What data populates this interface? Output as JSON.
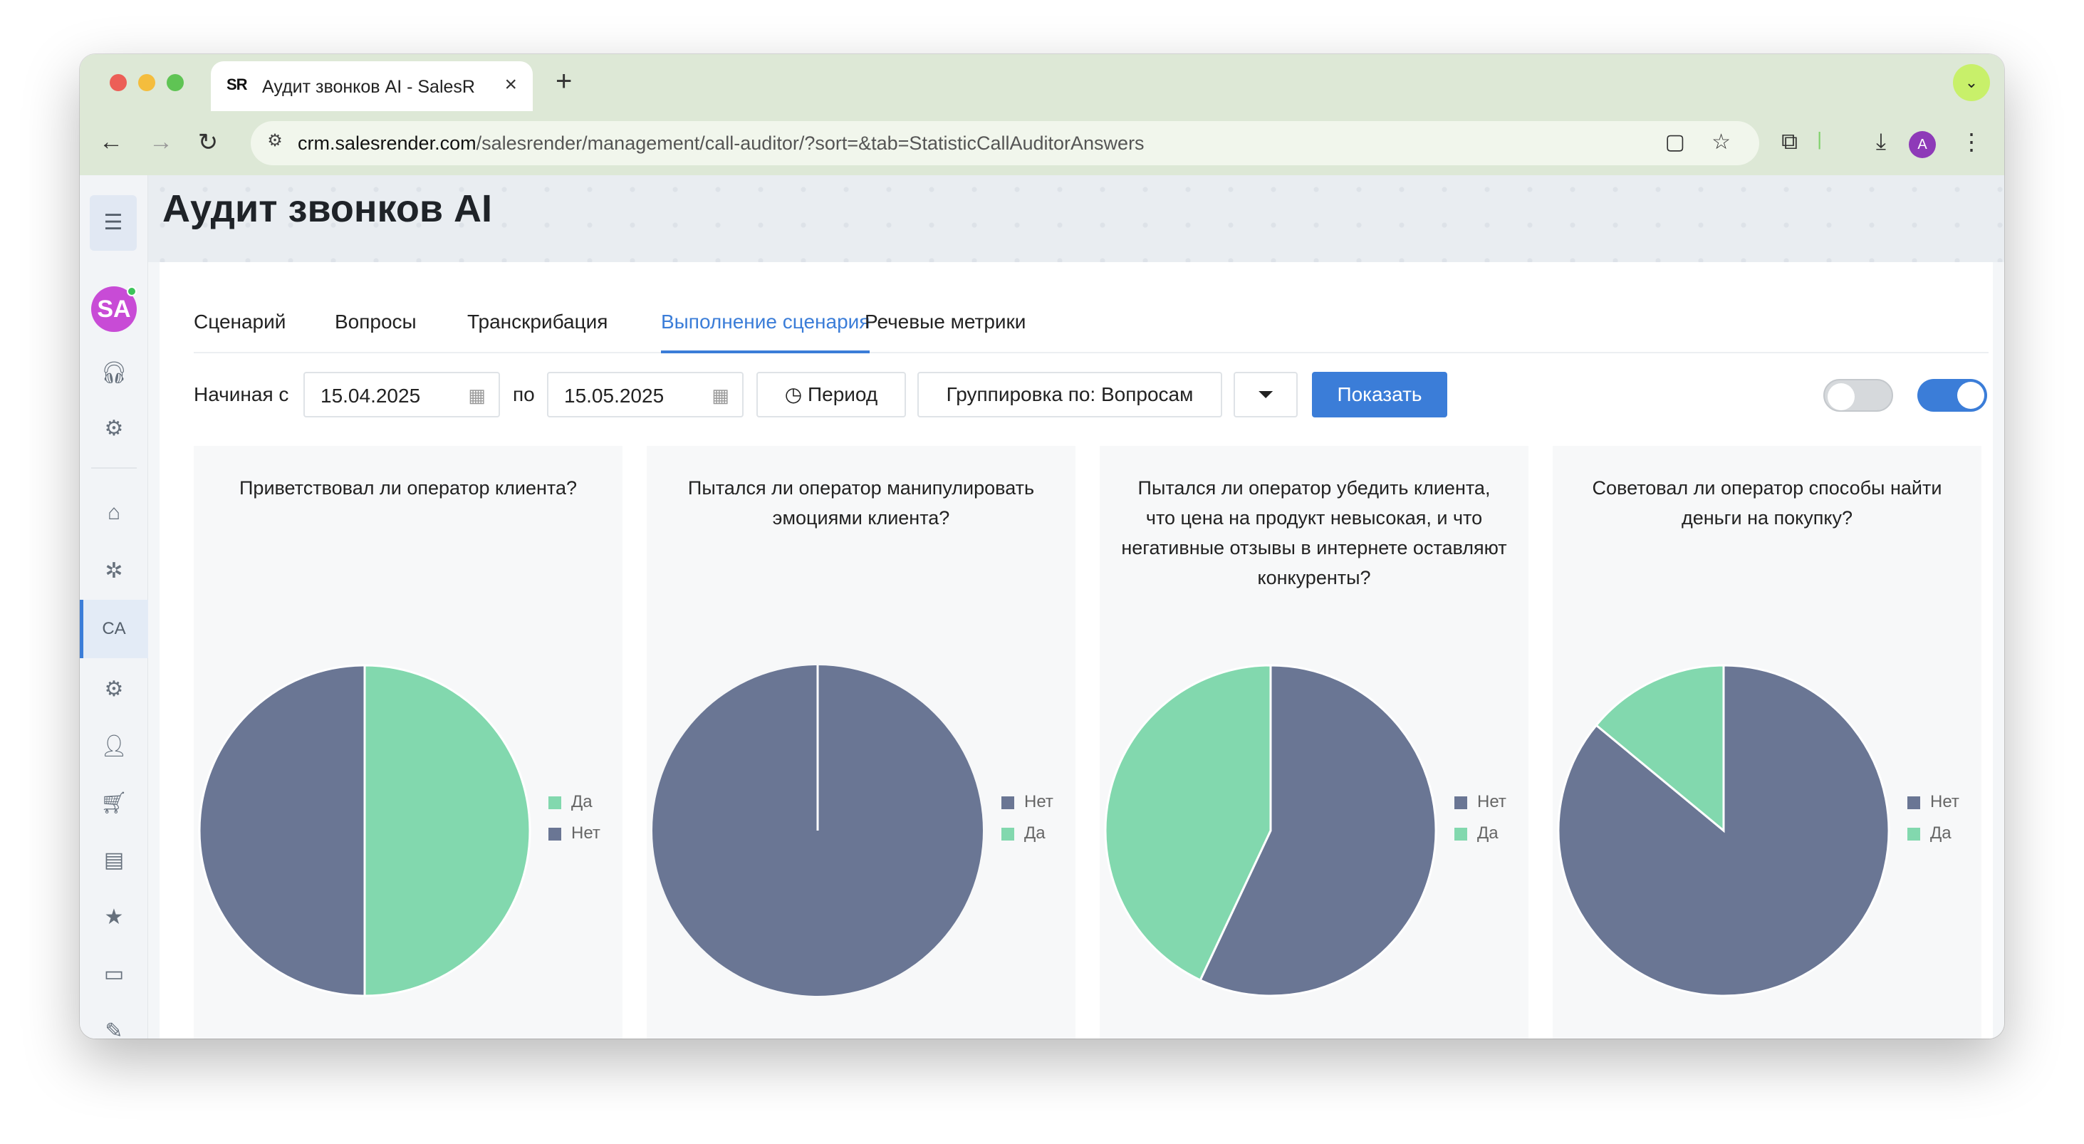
{
  "browser": {
    "tab_title": "Аудит звонков AI - SalesRender",
    "tab_favicon": "SR",
    "new_tab": "+",
    "url_domain": "crm.salesrender.com",
    "url_path": "/salesrender/management/call-auditor/?sort=&tab=StatisticCallAuditorAnswers",
    "profile_initial": "A"
  },
  "sidebar": {
    "user_initials": "SA",
    "active_item": "CA"
  },
  "page": {
    "title": "Аудит звонков AI",
    "tabs": [
      "Сценарий",
      "Вопросы",
      "Транскрибация",
      "Выполнение сценария",
      "Речевые метрики"
    ],
    "active_tab": "Выполнение сценария"
  },
  "filters": {
    "from_label": "Начиная с",
    "from_value": "15.04.2025",
    "to_label": "по",
    "to_value": "15.05.2025",
    "period_label": "Период",
    "group_label": "Группировка по: Вопросам",
    "show_label": "Показать"
  },
  "colors": {
    "yes": "#82d8ae",
    "no": "#6a7694",
    "accent": "#3b7dd8"
  },
  "chart_data": [
    {
      "type": "pie",
      "title": "Приветствовал ли оператор клиента?",
      "categories": [
        "Да",
        "Нет"
      ],
      "values": [
        50,
        50
      ],
      "colors": [
        "#82d8ae",
        "#6a7694"
      ],
      "legend": "right"
    },
    {
      "type": "pie",
      "title": "Пытался ли оператор манипулировать эмоциями клиента?",
      "categories": [
        "Нет",
        "Да"
      ],
      "values": [
        100,
        0
      ],
      "colors": [
        "#6a7694",
        "#82d8ae"
      ],
      "legend": "right"
    },
    {
      "type": "pie",
      "title": "Пытался ли оператор убедить клиента, что цена на продукт невысокая, и что негативные отзывы в интернете оставляют конкуренты?",
      "categories": [
        "Нет",
        "Да"
      ],
      "values": [
        57,
        43
      ],
      "colors": [
        "#6a7694",
        "#82d8ae"
      ],
      "legend": "right"
    },
    {
      "type": "pie",
      "title": "Советовал ли оператор способы найти деньги на покупку?",
      "categories": [
        "Нет",
        "Да"
      ],
      "values": [
        86,
        14
      ],
      "colors": [
        "#6a7694",
        "#82d8ae"
      ],
      "legend": "right"
    }
  ]
}
